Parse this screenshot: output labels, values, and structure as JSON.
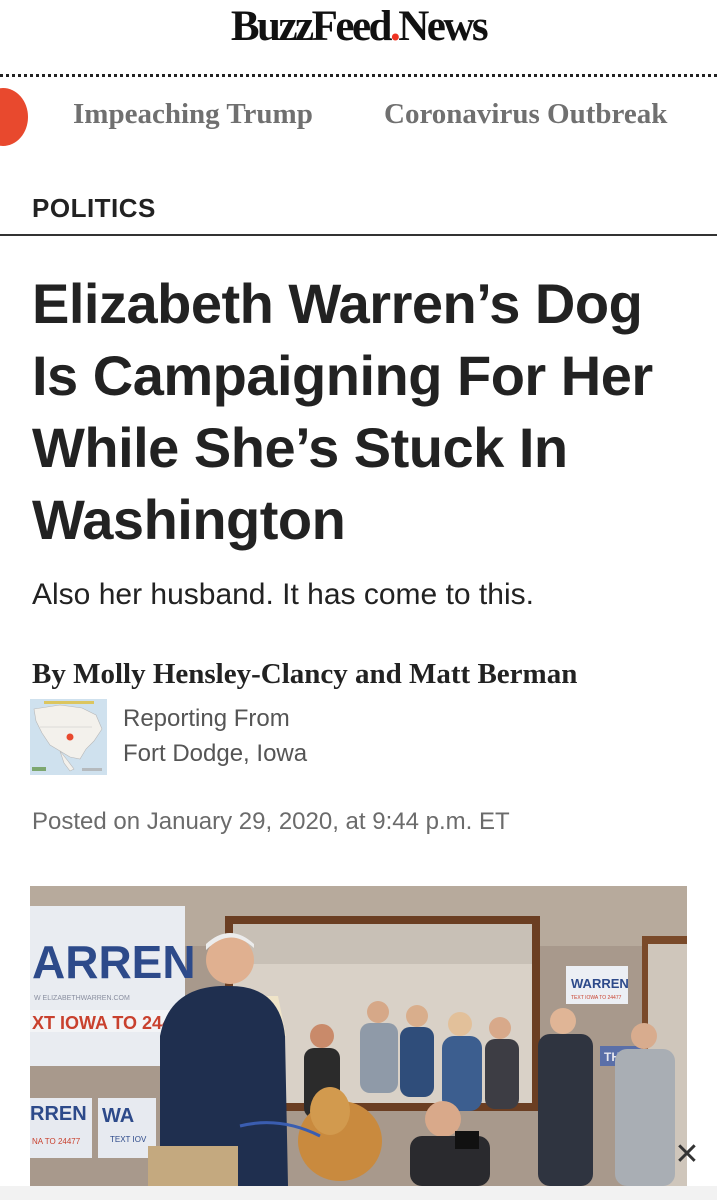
{
  "brand": {
    "logo_part1": "BuzzFeed",
    "logo_dot": ".",
    "logo_part2": "News",
    "accent_color": "#e8492e"
  },
  "nav": {
    "items": [
      {
        "label": "Impeaching Trump"
      },
      {
        "label": "Coronavirus Outbreak"
      }
    ]
  },
  "article": {
    "category": "POLITICS",
    "headline": "Elizabeth Warren’s Dog Is Campaigning For Her While She’s Stuck In Washington",
    "dek": "Also her husband. It has come to this.",
    "byline": "By Molly Hensley-Clancy and Matt Berman",
    "reporting_label": "Reporting From",
    "reporting_place": "Fort Dodge, Iowa",
    "timestamp": "Posted on January 29, 2020, at 9:44 p.m. ET"
  },
  "photo": {
    "signs": {
      "warren_big": "ARREN",
      "website": "W ELIZABETHWARREN.COM",
      "text_iowa_big": "XT IOWA TO 2447",
      "warren_small": "WARREN",
      "text_iowa_small": "TEXT IOWA TO 24477",
      "their": "THEIR",
      "rren": "RREN",
      "wa": "WA",
      "text_sub": "NA TO 24477",
      "text_io": "TEXT IOV"
    }
  },
  "icons": {
    "close": "close-icon",
    "map": "map-thumbnail"
  }
}
